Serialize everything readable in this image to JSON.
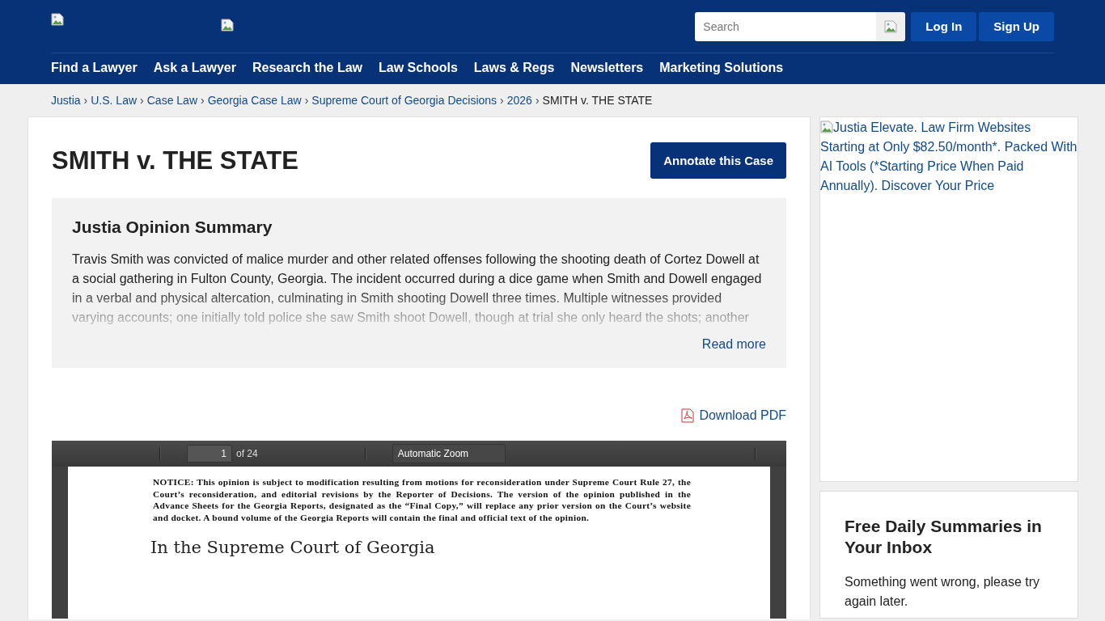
{
  "header": {
    "search": {
      "placeholder": "Search"
    },
    "buttons": [
      "Log In",
      "Sign Up"
    ],
    "nav": [
      "Find a Lawyer",
      "Ask a Lawyer",
      "Research the Law",
      "Law Schools",
      "Laws & Regs",
      "Newsletters",
      "Marketing Solutions"
    ]
  },
  "breadcrumbs": {
    "links": [
      "Justia",
      "U.S. Law",
      "Case Law",
      "Georgia Case Law",
      "Supreme Court of Georgia Decisions",
      "2026"
    ],
    "separator": "›",
    "current": "SMITH v. THE STATE"
  },
  "case": {
    "title": "SMITH v. THE STATE",
    "annotate_button": "Annotate this Case",
    "summary": {
      "heading": "Justia Opinion Summary",
      "text": "Travis Smith was convicted of malice murder and other related offenses following the shooting death of Cortez Dowell at a social gathering in Fulton County, Georgia. The incident occurred during a dice game when Smith and Dowell engaged in a verbal and physical altercation, culminating in Smith shooting Dowell three times. Multiple witnesses provided varying accounts; one initially told police she saw Smith shoot Dowell, though at trial she only heard the shots; another",
      "read_more": "Read more"
    },
    "download": "Download PDF",
    "pdf_viewer": {
      "page": "1",
      "page_count": "of 24",
      "zoom": "Automatic Zoom",
      "notice": "NOTICE: This opinion is subject to modification resulting from motions for reconsideration under Supreme Court Rule 27, the Court’s reconsideration, and editorial revisions by the Reporter of Decisions. The version of the opinion published in the Advance Sheets for the Georgia Reports, designated as the “Final Copy,” will replace any prior version on the Court’s website and docket. A bound volume of the Georgia Reports will contain the final and official text of the opinion.",
      "court_heading": "In the Supreme Court of Georgia"
    }
  },
  "sidebar": {
    "ad_alt_text": "Justia Elevate. Law Firm Websites Starting at Only $82.50/month*. Packed With AI Tools (*Starting Price When Paid Annually). Discover Your Price",
    "newsletter": {
      "heading": "Free Daily Summaries in Your Inbox",
      "message": "Something went wrong, please try again later."
    }
  }
}
